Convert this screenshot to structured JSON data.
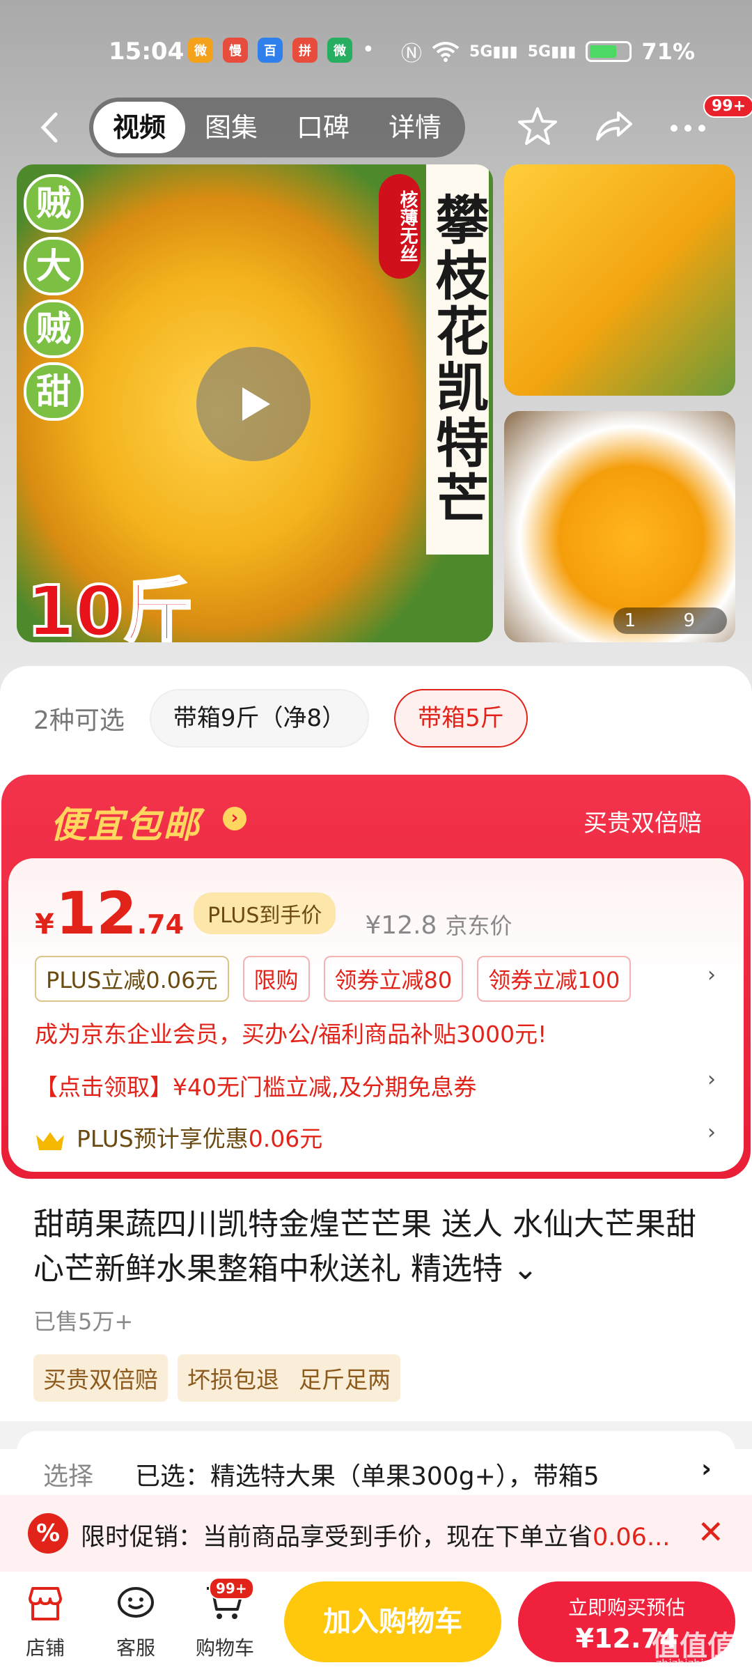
{
  "status_bar": {
    "time": "15:04",
    "battery": "71%",
    "battery_level": 0.71,
    "app_badges": [
      "微",
      "慢",
      "百",
      "拼",
      "微"
    ]
  },
  "nav": {
    "tabs": [
      "视频",
      "图集",
      "口碑",
      "详情"
    ],
    "active_tab": 0,
    "more_badge": "99+"
  },
  "gallery": {
    "main_badge_chars": [
      "贼",
      "大",
      "贼",
      "甜"
    ],
    "red_badge": "核薄无丝",
    "title_vertical": "攀枝花凯特芒",
    "weight_label": "10斤",
    "page_indicator": "1  9"
  },
  "variants": {
    "label": "2种可选",
    "options": [
      "带箱9斤（净8）",
      "带箱5斤"
    ],
    "selected": 1
  },
  "promo": {
    "title": "便宜包邮",
    "right_text": "买贵双倍赔",
    "price_symbol": "¥",
    "price_int": "12",
    "price_dec": ".74",
    "plus_tag": "PLUS到手价",
    "jd_price": "¥12.8",
    "jd_price_label": "京东价",
    "tags": [
      "PLUS立减0.06元",
      "限购",
      "领券立减80",
      "领券立减100"
    ],
    "enterprise_line": "成为京东企业会员，买办公/福利商品补贴3000元!",
    "coupon_line": "【点击领取】¥40无门槛立减,及分期免息券",
    "plus_line_prefix": "PLUS预计享优惠",
    "plus_line_value": "0.06元"
  },
  "product": {
    "title": "甜萌果蔬四川凯特金煌芒芒果 送人 水仙大芒果甜心芒新鲜水果整箱中秋送礼 精选特",
    "expand_glyph": "⌄",
    "sold": "已售5万+",
    "services": [
      "买贵双倍赔",
      "坏损包退",
      "足斤足两"
    ]
  },
  "selection": {
    "label": "选择",
    "value": "已选：精选特大果（单果300g+），带箱5",
    "arrow": "›"
  },
  "flash": {
    "icon": "%",
    "text_prefix": "限时促销：当前商品享受到手价，现在下单立省",
    "text_value": "0.06...",
    "close": "✕"
  },
  "bottom_bar": {
    "shop": "店铺",
    "service": "客服",
    "cart": "购物车",
    "cart_badge": "99+",
    "add_to_cart": "加入购物车",
    "buy_line1": "立即购买预估",
    "buy_line2": "¥12.74"
  },
  "watermark": {
    "main": "值值值",
    "sub": "zhizhizhi.com"
  },
  "colors": {
    "accent": "#e2231a",
    "promo_bg": "#e91e37",
    "cart_btn": "#ffc80d",
    "buy_btn": "#f0213d"
  }
}
